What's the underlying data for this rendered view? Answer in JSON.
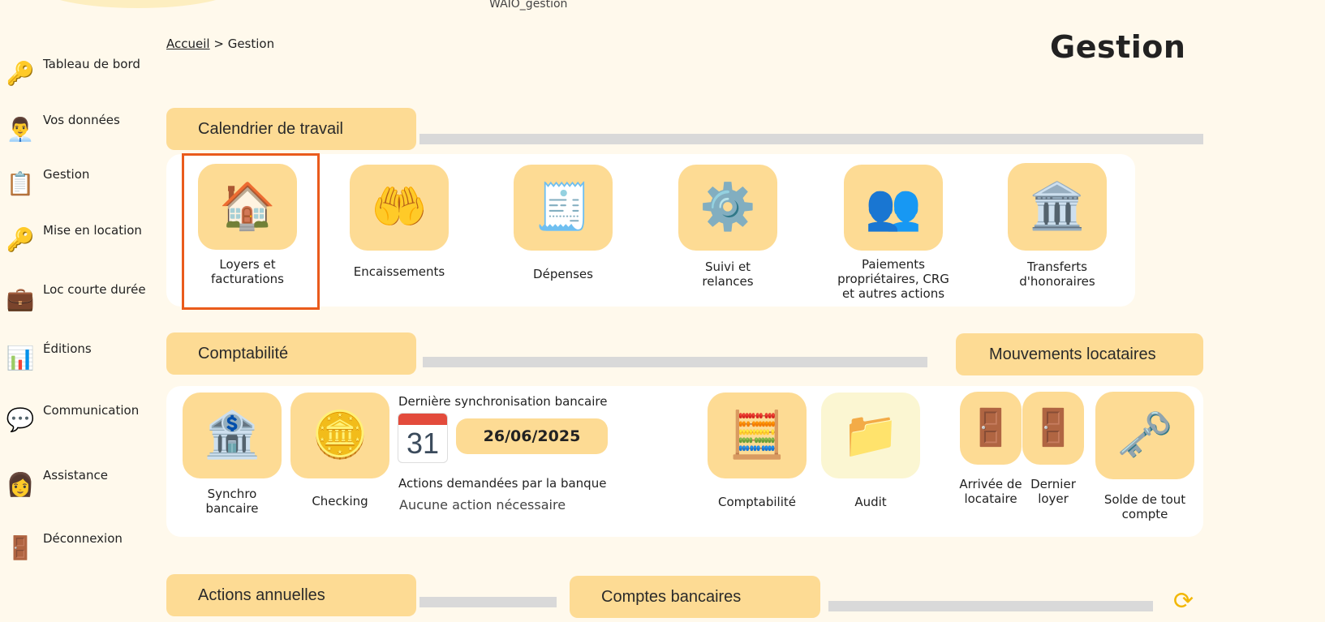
{
  "app": {
    "name": "WAIO_gestion"
  },
  "breadcrumb": {
    "home": "Accueil",
    "separator": ">",
    "current": "Gestion"
  },
  "page_title": "Gestion",
  "sidebar": {
    "items": [
      {
        "label": "Tableau de bord",
        "icon": "key-house-icon"
      },
      {
        "label": "Vos données",
        "icon": "user-icon"
      },
      {
        "label": "Gestion",
        "icon": "management-icon"
      },
      {
        "label": "Mise en location",
        "icon": "key-house-icon"
      },
      {
        "label": "Loc courte durée",
        "icon": "suitcase-icon"
      },
      {
        "label": "Éditions",
        "icon": "report-icon"
      },
      {
        "label": "Communication",
        "icon": "chat-icon"
      },
      {
        "label": "Assistance",
        "icon": "support-agent-icon"
      },
      {
        "label": "Déconnexion",
        "icon": "logout-icon"
      }
    ]
  },
  "sections": {
    "calendrier": {
      "title": "Calendrier de travail",
      "tiles": [
        {
          "label": "Loyers et facturations",
          "icon": "invoice-house-icon"
        },
        {
          "label": "Encaissements",
          "icon": "hand-coin-icon"
        },
        {
          "label": "Dépenses",
          "icon": "cheque-icon"
        },
        {
          "label": "Suivi et relances",
          "icon": "tasks-gear-icon"
        },
        {
          "label": "Paiements propriétaires, CRG et autres actions",
          "icon": "people-icon"
        },
        {
          "label": "Transferts d'honoraires",
          "icon": "bank-transfer-icon"
        }
      ]
    },
    "comptabilite": {
      "title": "Comptabilité",
      "tiles": [
        {
          "label": "Synchro bancaire",
          "icon": "bank-sync-icon"
        },
        {
          "label": "Checking",
          "icon": "checking-icon"
        },
        {
          "label": "Comptabilité",
          "icon": "accounting-icon"
        },
        {
          "label": "Audit",
          "icon": "audit-folder-icon"
        }
      ],
      "sync": {
        "label": "Dernière synchronisation bancaire",
        "calendar_day": "31",
        "date": "26/06/2025",
        "actions_label": "Actions demandées par la banque",
        "actions_value": "Aucune action nécessaire"
      }
    },
    "mouvements": {
      "title": "Mouvements locataires",
      "tiles": [
        {
          "label": "Arrivée de locataire",
          "icon": "door-enter-icon"
        },
        {
          "label": "Dernier loyer",
          "icon": "door-exit-icon"
        },
        {
          "label": "Solde de tout compte",
          "icon": "key-door-icon"
        }
      ]
    },
    "actions_annuelles": {
      "title": "Actions annuelles"
    },
    "comptes_bancaires": {
      "title": "Comptes bancaires"
    }
  },
  "colors": {
    "accent": "#fddb94",
    "background": "#fff9ec",
    "selected_frame": "#ea5b1c",
    "refresh": "#f2b705"
  }
}
